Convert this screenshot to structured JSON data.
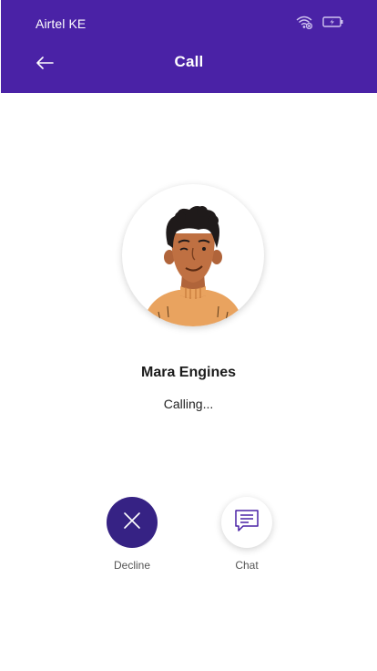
{
  "status_bar": {
    "carrier": "Airtel KE",
    "wifi_icon": "wifi-icon",
    "battery_icon": "battery-charging-icon"
  },
  "header": {
    "title": "Call",
    "back_icon": "arrow-left-icon",
    "background": "#4a22a6"
  },
  "contact": {
    "name": "Mara Engines",
    "status": "Calling...",
    "avatar_icon": "user-avatar-illustration"
  },
  "actions": {
    "decline": {
      "label": "Decline",
      "icon": "close-icon",
      "color": "#362284"
    },
    "chat": {
      "label": "Chat",
      "icon": "chat-icon",
      "color": "#4a22a6"
    }
  }
}
